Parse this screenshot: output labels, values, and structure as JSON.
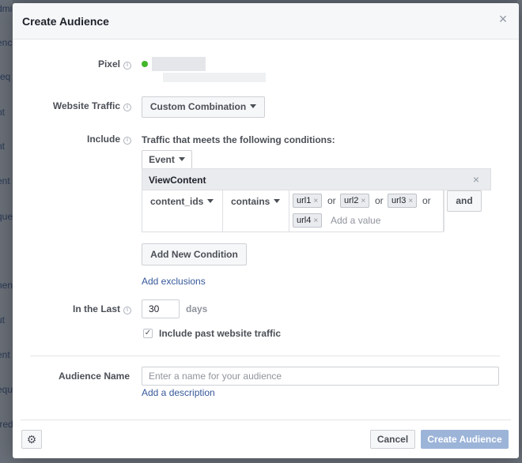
{
  "background": {
    "rows": [
      "dmi",
      "enc",
      "req",
      "nt",
      "nt",
      "ent",
      "que",
      "t",
      "nen",
      "ut",
      "ent",
      "equ",
      "fred"
    ]
  },
  "dialog": {
    "title": "Create Audience",
    "close_icon": "close-icon"
  },
  "form": {
    "pixel_label": "Pixel",
    "website_traffic_label": "Website Traffic",
    "website_traffic_value": "Custom Combination",
    "include_label": "Include",
    "include_condition_text": "Traffic that meets the following conditions:",
    "event_dropdown": "Event",
    "rule": {
      "event_name": "ViewContent",
      "parameter": "content_ids",
      "operator": "contains",
      "values": [
        "url1",
        "url2",
        "url3",
        "url4"
      ],
      "or_word": "or",
      "add_value_placeholder": "Add a value",
      "and_button": "and"
    },
    "add_condition_button": "Add New Condition",
    "add_exclusions_link": "Add exclusions",
    "in_the_last_label": "In the Last",
    "in_the_last_value": "30",
    "days_label": "days",
    "include_past_traffic_label": "Include past website traffic",
    "include_past_traffic_checked": true,
    "audience_name_label": "Audience Name",
    "audience_name_placeholder": "Enter a name for your audience",
    "add_description_link": "Add a description"
  },
  "footer": {
    "settings_icon": "gear-icon",
    "cancel_button": "Cancel",
    "create_button": "Create Audience"
  },
  "colors": {
    "primary_disabled": "#9cb4d8",
    "link": "#365899",
    "status_green": "#42b72a"
  }
}
